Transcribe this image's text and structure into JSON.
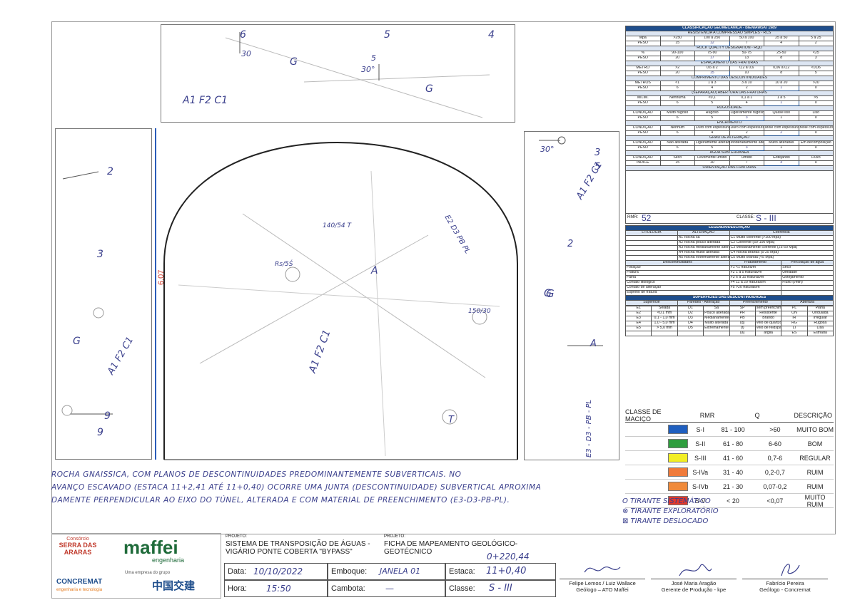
{
  "sketch": {
    "top_panel_label": "A1 F2 C1",
    "top_panel_marks": [
      "6",
      "5",
      "4",
      "G",
      "G",
      "30°",
      "30",
      "5"
    ],
    "left_panel_label": "A1 F2 C1",
    "left_panel_marks": [
      "2",
      "3",
      "9",
      "9",
      "G"
    ],
    "right_panel_label": "A1 F2 C1",
    "right_panel_marks": [
      "30°",
      "3",
      "5",
      "2",
      "G",
      "A"
    ],
    "dimension": "6,07",
    "arch_marks": [
      "A",
      "Rs/5Ś",
      "140/54 T",
      "E2 D3 PB PL",
      "150/30",
      "A1 F2 C1",
      "G",
      "E3 - D3 - PB - PL",
      "T"
    ]
  },
  "notes": {
    "line1": "ROCHA GNAISSICA, COM PLANOS DE DESCONTINUIDADES PREDOMINANTEMENTE SUBVERTICAIS. NO",
    "line2": "AVANÇO ESCAVADO (ESTACA 11+2,41 ATÉ 11+0,40) OCORRE UMA JUNTA (DESCONTINUIDADE) SUBVERTICAL APROXIMA",
    "line3": "DAMENTE PERPENDICULAR AO EIXO DO TÚNEL, ALTERADA E COM MATERIAL DE PREENCHIMENTO (E3-D3-PB-PL)."
  },
  "rmr": {
    "title": "CLASSIFICAÇÃO GEOMECÂNICA - BIENIAWSKI 1989",
    "rcs_header": "RESISTÊNCIA A COMPRESSÃO SIMPLES - RCS",
    "rcs_row1": [
      "Mpa",
      ">250",
      "100 a 250",
      "50 a 100",
      "25 a 50",
      "5 a 25"
    ],
    "rcs_row2": [
      "PESO",
      "15",
      "12",
      "7",
      "4",
      "2"
    ],
    "rqd_header": "ROCK QUALITY DESIGNATION - RQD",
    "rqd_row1": [
      "%",
      "90-100",
      "75-90",
      "50-75",
      "25-50",
      "<25"
    ],
    "rqd_row2": [
      "PESO",
      "20",
      "17",
      "13",
      "8",
      "3"
    ],
    "esp_header": "ESPAÇAMENTO DAS FRATURAS",
    "esp_row1": [
      "METRO",
      ">2",
      "0,6 a 2",
      "0,2 a 0,6",
      "0,06 a 0,2",
      "<0,06"
    ],
    "esp_row2": [
      "PESO",
      "20",
      "15",
      "10",
      "8",
      "5"
    ],
    "comp_header": "COMPRIMENTO DAS DESCONTINUIDADES",
    "comp_row1": [
      "METROS",
      "<1",
      "1 a 3",
      "3 a 10",
      "10 a 20",
      ">20"
    ],
    "comp_row2": [
      "PESO",
      "6",
      "4",
      "2",
      "1",
      "0"
    ],
    "sep_header": "(SEPARAÇÃO) ABERTURA DAS FRATURAS",
    "sep_row1": [
      "MILIM.",
      "Nenhuma",
      "<0,1",
      "0,1 a 1",
      "1 a 5",
      ">5"
    ],
    "sep_row2": [
      "PESO",
      "6",
      "5",
      "4",
      "1",
      "0"
    ],
    "rug_header": "RUGOSIDADE",
    "rug_row1": [
      "CONDIÇÃO",
      "Muito rugoso",
      "Rugoso",
      "Ligeiramente rugoso",
      "Quase liso",
      "Liso"
    ],
    "rug_row2": [
      "PESO",
      "6",
      "5",
      "3",
      "1",
      "0"
    ],
    "ench_header": "ENCHIMENTO",
    "ench_row1": [
      "CONDIÇÃO",
      "Nenhum",
      "Duro com espessura <5mm",
      "Duro com espessura >5mm",
      "Mole com espessura <5mm",
      "Mole com espessura >5mm"
    ],
    "ench_row2": [
      "PESO",
      "6",
      "4",
      "2",
      "2",
      "0"
    ],
    "alt_header": "GRAU DE ALTERAÇÃO",
    "alt_row1": [
      "CONDIÇÃO",
      "Não alterada",
      "Ligeiramente alteradas",
      "Moderadamente alteradas",
      "Muito alteradas",
      "Em decomposição"
    ],
    "alt_row2": [
      "PESO",
      "6",
      "5",
      "3",
      "1",
      "0"
    ],
    "agua_header": "ÁGUA SUBTERRÂNEA",
    "agua_row1": [
      "CONDIÇÃO",
      "Seco",
      "Levemente úmido",
      "Úmido",
      "Gotejando",
      "Fluxo"
    ],
    "agua_row2": [
      "ÍNDICE",
      "15",
      "10",
      "7",
      "4",
      "0"
    ],
    "ori_header": "ORIENTAÇÃO DAS FRATURAS",
    "rmr_label": "RMR:",
    "rmr_value": "52",
    "class_label": "CLASSE:",
    "class_value": "S - III"
  },
  "legend": {
    "title": "LEGENDA/DESCRIÇÃO",
    "litologia": "LITOLOGIA",
    "alteracao": "ALTERAÇÃO",
    "coerencia": "Coerência",
    "alt_items": [
      "A1 Rocha sã",
      "A2 Rocha pouco alterada",
      "A3 Rocha medianamente alterada",
      "A4 Rocha muito alterada",
      "A5 Rocha extremamente alterada"
    ],
    "coer_items": [
      "C1 Muito coerente (>100 Mpa)",
      "C2 Coerente (50-100 Mpa)",
      "C3 Medianamente coerente (25-50 Mpa)",
      "C4 Rocha branda (5-25 Mpa)",
      "C5 Muito branda (<5 Mpa)"
    ],
    "disc_title": "Descontinuidades",
    "frat_title": "Fraturamento",
    "perc_title": "Percolação de água",
    "disc_items": [
      "Foliação",
      "Fratura",
      "Falha",
      "Contato litológico",
      "Contato de alteração",
      "Espelho de fratura"
    ],
    "frat_items": [
      "F1 <1 fratura/m",
      "F2 1 a 5 fraturas/m",
      "F3 6 a 10 fraturas/m",
      "F4 11 a 20 fraturas/m",
      "F5 >20 fraturas/m"
    ],
    "perc_items": [
      "Seco",
      "Umidade",
      "Gotejamento",
      "Fluxo (l/min)"
    ],
    "surf_title": "SUPERFÍCIES DAS DESCONTINUIDADES",
    "surf_headers": [
      "Superfície",
      "Paredes - Alteração",
      "Preenchimento",
      "Abertura"
    ],
    "surf_rows": [
      [
        "E1",
        "Selada",
        "D1",
        "Sã",
        "SP",
        "sem preenchimento",
        "PL",
        "Plana"
      ],
      [
        "E2",
        "<0,1 mm",
        "D2",
        "Pouco alterada",
        "PR",
        "Resistente",
        "ON",
        "Ondulada"
      ],
      [
        "E3",
        "0,1 - 1,0 mm",
        "D3",
        "Medianamente alterada",
        "PB",
        "Brando",
        "IR",
        "Irregular"
      ],
      [
        "E4",
        "1,0 - 5,0 mm",
        "D4",
        "Muito alterada",
        "(q)",
        "veio de quartzo",
        "RG",
        "Rugosa"
      ],
      [
        "E5",
        "> 5,0 mm",
        "D5",
        "Extremamente alterada",
        "(f)",
        "veio de feldspato",
        "LI",
        "Lisa"
      ],
      [
        "",
        "",
        "",
        "",
        "(a)",
        "argila",
        "ES",
        "Estriada"
      ]
    ]
  },
  "classes": {
    "headers": [
      "CLASSE DE MACIÇO",
      "RMR",
      "Q",
      "DESCRIÇÃO"
    ],
    "rows": [
      {
        "cls": "S-I",
        "rmr": "81 - 100",
        "q": ">60",
        "desc": "MUITO BOM",
        "color": "#1f5fbf"
      },
      {
        "cls": "S-II",
        "rmr": "61 - 80",
        "q": "6-60",
        "desc": "BOM",
        "color": "#2e9e3e"
      },
      {
        "cls": "S-III",
        "rmr": "41 - 60",
        "q": "0,7-6",
        "desc": "REGULAR",
        "color": "#f2ee25"
      },
      {
        "cls": "S-IVa",
        "rmr": "31 - 40",
        "q": "0,2-0,7",
        "desc": "RUIM",
        "color": "#ef7a3a"
      },
      {
        "cls": "S-IVb",
        "rmr": "21 - 30",
        "q": "0,07-0,2",
        "desc": "RUIM",
        "color": "#f08a3a"
      },
      {
        "cls": "S-V",
        "rmr": "< 20",
        "q": "<0,07",
        "desc": "MUITO RUIM",
        "color": "#e2392b"
      }
    ]
  },
  "tirantes": {
    "line1": "O TIRANTE SISTEMÁTICO",
    "line2": "⊗ TIRANTE EXPLORATÓRIO",
    "line3": "⊠ TIRANTE DESLOCADO"
  },
  "footer": {
    "logo1_small": "Consórcio",
    "logo1_big": "SERRA DAS ARARAS",
    "logo2": "maffei",
    "logo2_sub": "engenharia",
    "logo3": "CONCREMAT",
    "logo3_sub": "engenharia e tecnologia",
    "logo4_small": "Uma empresa do grupo",
    "logo4": "中国交建",
    "projeto_label": "PROJETO:",
    "projeto_value": "SISTEMA DE TRANSPOSIÇÃO DE ÁGUAS - VIGÁRIO PONTE COBERTA \"BYPASS\"",
    "projeto2_label": "PROJETO:",
    "projeto2_value": "FICHA DE MAPEAMENTO GEOLÓGICO-GEOTÉCNICO",
    "extra_value": "0+220,44",
    "data_label": "Data:",
    "data_value": "10/10/2022",
    "emboque_label": "Emboque:",
    "emboque_value": "JANELA 01",
    "estaca_label": "Estaca:",
    "estaca_value": "11+0,40",
    "hora_label": "Hora:",
    "hora_value": "15:50",
    "cambota_label": "Cambota:",
    "cambota_value": "—",
    "classe_label": "Classe:",
    "classe_value": "S - III",
    "sig1_name": "Felipe Lemos / Luiz Wallace",
    "sig1_role": "Geólogo – ATO Maffei",
    "sig2_name": "José Maria Aragão",
    "sig2_role": "Gerente de Produção - kpe",
    "sig3_name": "Fabrício Pereira",
    "sig3_role": "Geólogo - Concremat"
  }
}
